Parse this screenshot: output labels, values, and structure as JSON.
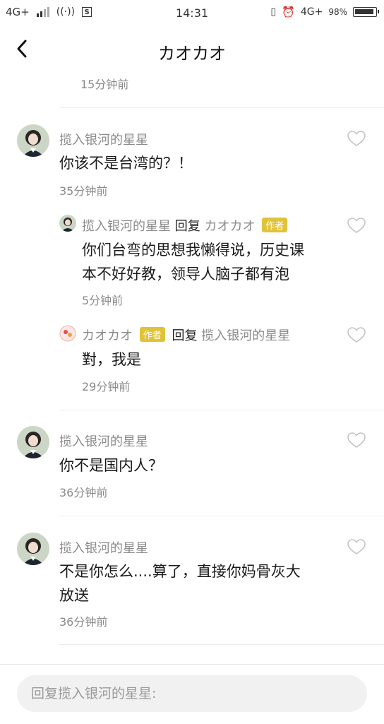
{
  "status_bar": {
    "network_left": "4G+",
    "time": "14:31",
    "network_right": "4G+",
    "battery": "98%",
    "icons": [
      "signal-icon",
      "hotspot-icon",
      "s-icon",
      "vibrate-icon",
      "alarm-icon",
      "battery-icon"
    ]
  },
  "header": {
    "title": "カオカオ",
    "back_icon": "chevron-left-icon"
  },
  "top_time": "15分钟前",
  "comments": [
    {
      "user": "揽入银河的星星",
      "text": "你该不是台湾的？！",
      "time": "35分钟前",
      "replies": [
        {
          "user": "揽入银河的星星",
          "reply_word": "回复",
          "target": "カオカオ",
          "badge": "作者",
          "text_line1": "你们台弯的思想我懒得说，历史课",
          "text_line2": "本不好好教，领导人脑子都有泡",
          "time": "5分钟前"
        },
        {
          "user": "カオカオ",
          "badge": "作者",
          "reply_word": "回复",
          "target": "揽入银河的星星",
          "text": "對，我是",
          "time": "29分钟前"
        }
      ]
    },
    {
      "user": "揽入银河的星星",
      "text": "你不是国内人？",
      "time": "36分钟前"
    },
    {
      "user": "揽入银河的星星",
      "text_line1": "不是你怎么....算了，直接你妈骨灰大",
      "text_line2": "放送",
      "time": "36分钟前"
    }
  ],
  "reply_input": {
    "placeholder": "回复揽入银河的星星:"
  },
  "colors": {
    "author_badge": "#e0c33a",
    "muted_text": "#8a8a8a",
    "divider": "#ececec"
  }
}
